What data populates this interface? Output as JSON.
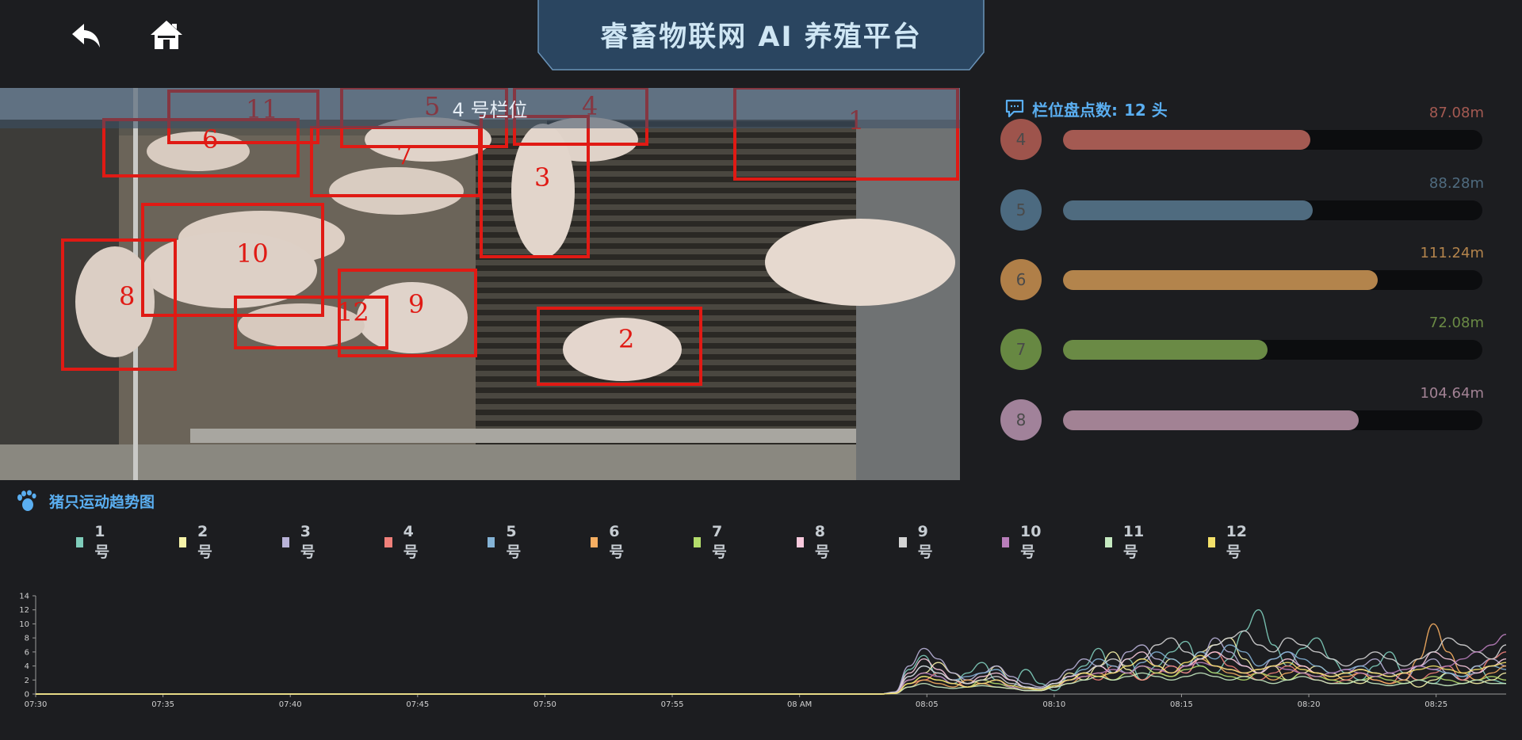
{
  "header": {
    "title": "睿畜物联网 AI 养殖平台",
    "back_icon": "back-arrow-icon",
    "home_icon": "home-icon"
  },
  "video": {
    "caption": "4 号栏位",
    "detections": [
      "1",
      "2",
      "3",
      "4",
      "5",
      "6",
      "7",
      "8",
      "9",
      "10",
      "11",
      "12"
    ]
  },
  "count": {
    "label": "栏位盘点数:",
    "value": "12 头",
    "icon": "chat-bubble-icon"
  },
  "distance_bars": [
    {
      "id": "4",
      "value": "87.08m",
      "fraction": 0.59,
      "color": "#a45a52",
      "circle": "#9e544c"
    },
    {
      "id": "5",
      "value": "88.28m",
      "fraction": 0.595,
      "color": "#4f6b7f",
      "circle": "#4c6a80"
    },
    {
      "id": "6",
      "value": "111.24m",
      "fraction": 0.75,
      "color": "#b3844c",
      "circle": "#b07f48"
    },
    {
      "id": "7",
      "value": "72.08m",
      "fraction": 0.487,
      "color": "#6a8a45",
      "circle": "#678842"
    },
    {
      "id": "8",
      "value": "104.64m",
      "fraction": 0.706,
      "color": "#a28294",
      "circle": "#a1829a"
    }
  ],
  "trend": {
    "title": "猪只运动趋势图",
    "icon": "footprint-icon"
  },
  "legend": [
    {
      "label": "1号",
      "color": "#7fcdbb"
    },
    {
      "label": "2号",
      "color": "#f7f3a8"
    },
    {
      "label": "3号",
      "color": "#b9b3d8"
    },
    {
      "label": "4号",
      "color": "#f0807a"
    },
    {
      "label": "5号",
      "color": "#84b3d6"
    },
    {
      "label": "6号",
      "color": "#f6ae62"
    },
    {
      "label": "7号",
      "color": "#b4dd6c"
    },
    {
      "label": "8号",
      "color": "#f8c9dd"
    },
    {
      "label": "9号",
      "color": "#d4d4d4"
    },
    {
      "label": "10号",
      "color": "#b97ebb"
    },
    {
      "label": "11号",
      "color": "#c6eac1"
    },
    {
      "label": "12号",
      "color": "#f4e16a"
    }
  ],
  "chart_data": {
    "type": "line",
    "x": [
      "07:30",
      "07:35",
      "07:40",
      "07:45",
      "07:50",
      "07:55",
      "08 AM",
      "08:05",
      "08:10",
      "08:15",
      "08:20",
      "08:25"
    ],
    "ylim": [
      0,
      14
    ],
    "yticks": [
      "0",
      "2",
      "4",
      "6",
      "8",
      "10",
      "12",
      "14"
    ],
    "grid": false,
    "series": [
      {
        "name": "1号",
        "values": [
          0,
          0,
          0,
          0,
          0,
          0,
          0,
          0,
          0,
          0,
          0,
          0,
          0,
          0,
          0,
          0,
          0,
          0,
          0,
          0,
          0,
          0,
          0,
          0,
          0,
          0,
          0,
          0,
          0,
          0,
          0,
          0,
          0,
          0,
          0,
          0,
          0,
          0,
          0,
          0,
          0,
          0,
          0,
          0,
          0,
          0,
          0,
          0,
          0,
          0,
          0,
          0,
          0,
          0,
          0,
          0,
          0,
          0,
          0,
          0.2,
          3.5,
          5.5,
          2.5,
          1.5,
          3,
          4.5,
          2,
          1,
          3.5,
          1.5,
          0.5,
          2.5,
          4,
          6.5,
          3,
          5,
          2,
          4,
          6,
          7.5,
          4,
          3,
          5,
          9,
          12,
          7,
          4,
          6.5,
          8,
          5,
          3,
          2,
          4,
          6,
          3,
          2,
          1.5,
          3,
          2.5,
          4,
          2,
          1.5
        ]
      },
      {
        "name": "2号",
        "values": [
          0,
          0,
          0,
          0,
          0,
          0,
          0,
          0,
          0,
          0,
          0,
          0,
          0,
          0,
          0,
          0,
          0,
          0,
          0,
          0,
          0,
          0,
          0,
          0,
          0,
          0,
          0,
          0,
          0,
          0,
          0,
          0,
          0,
          0,
          0,
          0,
          0,
          0,
          0,
          0,
          0,
          0,
          0,
          0,
          0,
          0,
          0,
          0,
          0,
          0,
          0,
          0,
          0,
          0,
          0,
          0,
          0,
          0,
          0,
          0.1,
          2,
          3,
          4.5,
          3,
          1.5,
          2,
          4,
          2,
          1,
          0.5,
          1,
          3,
          2,
          4,
          6,
          3.5,
          2,
          3,
          5,
          4,
          6,
          7,
          8,
          5,
          3,
          4,
          2,
          3,
          4,
          3,
          2,
          1.5,
          2.5,
          3,
          2,
          1,
          2,
          3,
          2,
          1.5,
          2,
          3
        ]
      },
      {
        "name": "3号",
        "values": [
          0,
          0,
          0,
          0,
          0,
          0,
          0,
          0,
          0,
          0,
          0,
          0,
          0,
          0,
          0,
          0,
          0,
          0,
          0,
          0,
          0,
          0,
          0,
          0,
          0,
          0,
          0,
          0,
          0,
          0,
          0,
          0,
          0,
          0,
          0,
          0,
          0,
          0,
          0,
          0,
          0,
          0,
          0,
          0,
          0,
          0,
          0,
          0,
          0,
          0,
          0,
          0,
          0,
          0,
          0,
          0,
          0,
          0,
          0,
          0.3,
          4,
          6.5,
          5,
          3,
          2,
          3,
          4,
          2.5,
          1.5,
          1,
          2,
          3.5,
          5,
          4,
          3,
          6,
          7,
          5,
          4,
          3,
          5,
          8,
          6,
          4,
          3,
          5,
          6,
          4,
          3,
          2.5,
          3,
          4,
          5,
          3,
          2,
          4,
          5,
          3,
          2,
          4,
          5,
          4
        ]
      },
      {
        "name": "4号",
        "values": [
          0,
          0,
          0,
          0,
          0,
          0,
          0,
          0,
          0,
          0,
          0,
          0,
          0,
          0,
          0,
          0,
          0,
          0,
          0,
          0,
          0,
          0,
          0,
          0,
          0,
          0,
          0,
          0,
          0,
          0,
          0,
          0,
          0,
          0,
          0,
          0,
          0,
          0,
          0,
          0,
          0,
          0,
          0,
          0,
          0,
          0,
          0,
          0,
          0,
          0,
          0,
          0,
          0,
          0,
          0,
          0,
          0,
          0,
          0,
          0.1,
          1.5,
          2,
          3,
          2,
          1,
          1.5,
          2,
          1,
          0.5,
          0.5,
          1,
          2,
          3,
          2,
          4,
          3,
          2,
          3,
          4,
          3,
          5,
          6,
          4,
          3,
          2,
          3,
          4,
          3,
          2,
          1.5,
          2,
          3,
          2,
          1.5,
          3,
          2,
          3,
          4,
          2,
          3,
          5,
          6
        ]
      },
      {
        "name": "5号",
        "values": [
          0,
          0,
          0,
          0,
          0,
          0,
          0,
          0,
          0,
          0,
          0,
          0,
          0,
          0,
          0,
          0,
          0,
          0,
          0,
          0,
          0,
          0,
          0,
          0,
          0,
          0,
          0,
          0,
          0,
          0,
          0,
          0,
          0,
          0,
          0,
          0,
          0,
          0,
          0,
          0,
          0,
          0,
          0,
          0,
          0,
          0,
          0,
          0,
          0,
          0,
          0,
          0,
          0,
          0,
          0,
          0,
          0,
          0,
          0,
          0.2,
          2.5,
          4,
          3,
          2,
          2.5,
          3,
          3.5,
          2,
          1,
          0.8,
          1.5,
          2.5,
          3.5,
          5,
          4,
          3,
          4.5,
          6,
          5,
          4,
          6,
          5,
          7,
          6,
          4,
          5,
          6,
          5,
          4,
          3,
          3.5,
          4,
          3,
          2.5,
          3,
          4,
          3.5,
          3,
          2.5,
          3,
          4,
          3.5
        ]
      },
      {
        "name": "6号",
        "values": [
          0,
          0,
          0,
          0,
          0,
          0,
          0,
          0,
          0,
          0,
          0,
          0,
          0,
          0,
          0,
          0,
          0,
          0,
          0,
          0,
          0,
          0,
          0,
          0,
          0,
          0,
          0,
          0,
          0,
          0,
          0,
          0,
          0,
          0,
          0,
          0,
          0,
          0,
          0,
          0,
          0,
          0,
          0,
          0,
          0,
          0,
          0,
          0,
          0,
          0,
          0,
          0,
          0,
          0,
          0,
          0,
          0,
          0,
          0,
          0.1,
          1,
          2,
          1.5,
          1,
          2,
          1.5,
          1,
          0.8,
          0.5,
          0.5,
          1,
          1.5,
          2.5,
          3,
          2,
          3,
          4,
          3,
          2.5,
          4,
          5,
          4,
          3,
          2.5,
          3,
          2,
          3,
          4,
          3,
          2,
          2.5,
          3,
          2,
          1.5,
          2,
          5,
          10,
          6,
          3,
          2,
          3,
          4
        ]
      },
      {
        "name": "7号",
        "values": [
          0,
          0,
          0,
          0,
          0,
          0,
          0,
          0,
          0,
          0,
          0,
          0,
          0,
          0,
          0,
          0,
          0,
          0,
          0,
          0,
          0,
          0,
          0,
          0,
          0,
          0,
          0,
          0,
          0,
          0,
          0,
          0,
          0,
          0,
          0,
          0,
          0,
          0,
          0,
          0,
          0,
          0,
          0,
          0,
          0,
          0,
          0,
          0,
          0,
          0,
          0,
          0,
          0,
          0,
          0,
          0,
          0,
          0,
          0,
          0.1,
          1.5,
          2.5,
          2,
          1.5,
          1,
          2,
          1.5,
          1,
          0.5,
          0.5,
          1.5,
          2,
          3,
          2.5,
          2,
          3,
          4,
          3,
          2.5,
          3.5,
          4,
          3,
          2.5,
          2,
          3,
          2.5,
          2,
          3,
          2.5,
          2,
          1.5,
          2,
          2.5,
          2,
          1.5,
          2,
          2.5,
          2,
          1.5,
          2,
          2.5,
          2
        ]
      },
      {
        "name": "8号",
        "values": [
          0,
          0,
          0,
          0,
          0,
          0,
          0,
          0,
          0,
          0,
          0,
          0,
          0,
          0,
          0,
          0,
          0,
          0,
          0,
          0,
          0,
          0,
          0,
          0,
          0,
          0,
          0,
          0,
          0,
          0,
          0,
          0,
          0,
          0,
          0,
          0,
          0,
          0,
          0,
          0,
          0,
          0,
          0,
          0,
          0,
          0,
          0,
          0,
          0,
          0,
          0,
          0,
          0,
          0,
          0,
          0,
          0,
          0,
          0,
          0.2,
          3,
          5,
          3.5,
          2,
          1.5,
          2.5,
          3,
          2,
          1,
          0.8,
          1.5,
          2.5,
          3,
          4,
          3,
          5,
          6,
          4,
          3,
          4,
          5,
          6,
          5,
          4,
          3,
          4,
          5,
          4,
          3,
          2.5,
          3,
          3.5,
          3,
          2.5,
          3,
          4,
          6,
          5,
          4,
          3,
          4,
          5
        ]
      },
      {
        "name": "9号",
        "values": [
          0,
          0,
          0,
          0,
          0,
          0,
          0,
          0,
          0,
          0,
          0,
          0,
          0,
          0,
          0,
          0,
          0,
          0,
          0,
          0,
          0,
          0,
          0,
          0,
          0,
          0,
          0,
          0,
          0,
          0,
          0,
          0,
          0,
          0,
          0,
          0,
          0,
          0,
          0,
          0,
          0,
          0,
          0,
          0,
          0,
          0,
          0,
          0,
          0,
          0,
          0,
          0,
          0,
          0,
          0,
          0,
          0,
          0,
          0,
          0.2,
          2.5,
          4,
          3,
          2,
          1.5,
          2,
          2.5,
          1.5,
          1,
          0.8,
          1.5,
          2,
          3,
          4,
          5,
          4,
          5,
          7,
          8,
          6,
          5,
          7,
          8,
          9,
          7,
          6,
          8,
          7,
          6,
          5,
          4,
          5,
          6,
          5,
          4,
          5,
          6,
          8,
          7,
          6,
          5,
          7
        ]
      },
      {
        "name": "10号",
        "values": [
          0,
          0,
          0,
          0,
          0,
          0,
          0,
          0,
          0,
          0,
          0,
          0,
          0,
          0,
          0,
          0,
          0,
          0,
          0,
          0,
          0,
          0,
          0,
          0,
          0,
          0,
          0,
          0,
          0,
          0,
          0,
          0,
          0,
          0,
          0,
          0,
          0,
          0,
          0,
          0,
          0,
          0,
          0,
          0,
          0,
          0,
          0,
          0,
          0,
          0,
          0,
          0,
          0,
          0,
          0,
          0,
          0,
          0,
          0,
          0.1,
          2,
          3,
          2.5,
          1.5,
          1,
          1.5,
          2,
          1,
          0.5,
          0.5,
          1,
          2,
          2.5,
          3,
          3.5,
          3,
          4,
          3.5,
          3,
          4,
          4.5,
          4,
          3.5,
          3,
          3.5,
          4,
          3.5,
          3,
          2.5,
          3,
          3.5,
          3,
          2.5,
          3,
          3.5,
          4,
          3.5,
          4,
          5,
          6,
          7,
          8.5
        ]
      },
      {
        "name": "11号",
        "values": [
          0,
          0,
          0,
          0,
          0,
          0,
          0,
          0,
          0,
          0,
          0,
          0,
          0,
          0,
          0,
          0,
          0,
          0,
          0,
          0,
          0,
          0,
          0,
          0,
          0,
          0,
          0,
          0,
          0,
          0,
          0,
          0,
          0,
          0,
          0,
          0,
          0,
          0,
          0,
          0,
          0,
          0,
          0,
          0,
          0,
          0,
          0,
          0,
          0,
          0,
          0,
          0,
          0,
          0,
          0,
          0,
          0,
          0,
          0,
          0.1,
          1,
          1.5,
          1,
          0.8,
          1,
          1.2,
          1,
          0.8,
          0.5,
          0.5,
          1,
          1.5,
          2,
          2.5,
          2,
          2.5,
          3,
          2.5,
          2,
          2.5,
          3,
          2.5,
          2,
          2.5,
          2,
          1.5,
          2,
          2.5,
          2,
          1.5,
          1.5,
          2,
          1.5,
          1.2,
          1.5,
          2,
          1.5,
          1.2,
          1.5,
          2,
          1.5,
          1.5
        ]
      },
      {
        "name": "12号",
        "values": [
          0,
          0,
          0,
          0,
          0,
          0,
          0,
          0,
          0,
          0,
          0,
          0,
          0,
          0,
          0,
          0,
          0,
          0,
          0,
          0,
          0,
          0,
          0,
          0,
          0,
          0,
          0,
          0,
          0,
          0,
          0,
          0,
          0,
          0,
          0,
          0,
          0,
          0,
          0,
          0,
          0,
          0,
          0,
          0,
          0,
          0,
          0,
          0,
          0,
          0,
          0,
          0,
          0,
          0,
          0,
          0,
          0,
          0,
          0,
          0.1,
          1.5,
          2.5,
          2,
          1.5,
          1,
          1.5,
          2,
          1.2,
          0.8,
          0.6,
          1.2,
          2,
          3,
          2.5,
          3,
          4,
          5,
          4,
          3,
          4.5,
          5.5,
          4,
          3.5,
          3,
          3.5,
          4,
          4.5,
          3.5,
          3,
          2.5,
          3,
          3.5,
          3,
          2.5,
          3,
          3.5,
          4,
          3.5,
          3,
          3.5,
          4,
          4.5
        ]
      }
    ]
  }
}
